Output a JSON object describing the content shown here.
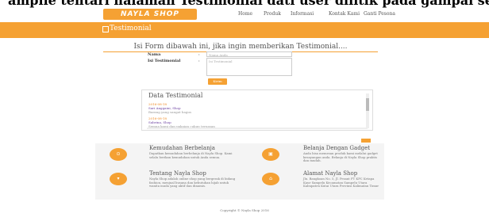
{
  "top_caption": "ampile tentari halaman Testimonial dati user dilitik pada gampai sebag",
  "brand": "NAYLA SHOP",
  "nav": [
    "Home",
    "Produk",
    "Informasi",
    "Kontak Kami",
    "Ganti Pesona"
  ],
  "banner_title": "Testimonial",
  "form": {
    "heading": "Isi Form dibawah ini, jika ingin memberikan Testimonial....",
    "name_label": "Nama",
    "name_placeholder": "Nama Anda",
    "message_label": "Isi Testimonial",
    "message_placeholder": "Isi Testimonial",
    "colon": ":",
    "submit": "Kirim"
  },
  "data_testimonial": {
    "title": "Data Testimonial",
    "entries": [
      {
        "date": "2016-08-18",
        "name": "Sari Anggaini, Shop",
        "message": "Barang yang sangat bagus"
      },
      {
        "date": "2016-08-18",
        "name": "Sabrina, Shop",
        "message": "Semua kami dan pakaian cukup terpasan"
      }
    ]
  },
  "info": [
    {
      "icon": "cart-icon",
      "title": "Kemudahan Berbelanja",
      "text": "Dapatkan kemudahan berbelanja di Nayla Shop. Kami selalu berikan kemudahan untuk Anda semua."
    },
    {
      "icon": "gift-icon",
      "title": "Belanja Dengan Gadget",
      "text": "Anda bisa memesan produk kami melalui gadget kesayangan anda. Belanja di Nayla Shop praktis dan mudah."
    },
    {
      "icon": "bag-icon",
      "title": "Tentang Nayla Shop",
      "text": "Nayla Shop adalah online shop yang bergerak di bidang fashion, menjual busana dan kebutuhan hijab untuk wanita muda yang aktif dan dinamis."
    },
    {
      "icon": "home-icon",
      "title": "Alamat Nayla Shop",
      "text": "Jln. Bangkoan No. 5, Jl. Pesant FT KPC Ketapa Kaur Sampelu Kecamatan Sampelu Utara Kabupaten Kutai Utara Provinsi Kalimatan Timur"
    }
  ],
  "footer": "Copyright © Nayla Shop 2016"
}
